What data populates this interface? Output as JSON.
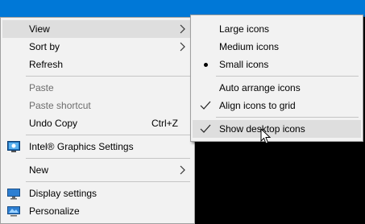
{
  "main_menu": {
    "view": "View",
    "sort_by": "Sort by",
    "refresh": "Refresh",
    "paste": "Paste",
    "paste_shortcut": "Paste shortcut",
    "undo_copy": "Undo Copy",
    "undo_copy_shortcut": "Ctrl+Z",
    "intel_graphics": "Intel® Graphics Settings",
    "new": "New",
    "display_settings": "Display settings",
    "personalize": "Personalize"
  },
  "view_submenu": {
    "large_icons": "Large icons",
    "medium_icons": "Medium icons",
    "small_icons": "Small icons",
    "auto_arrange": "Auto arrange icons",
    "align_to_grid": "Align icons to grid",
    "show_desktop_icons": "Show desktop icons"
  },
  "colors": {
    "desktop_accent": "#0078d7",
    "menu_background": "#f2f2f2",
    "highlight": "#dedede",
    "disabled_text": "#6d6d6d"
  },
  "icons": [
    "chevron-right-icon",
    "intel-graphics-icon",
    "display-settings-icon",
    "personalize-icon",
    "bullet-icon",
    "check-icon",
    "mouse-cursor-icon"
  ]
}
